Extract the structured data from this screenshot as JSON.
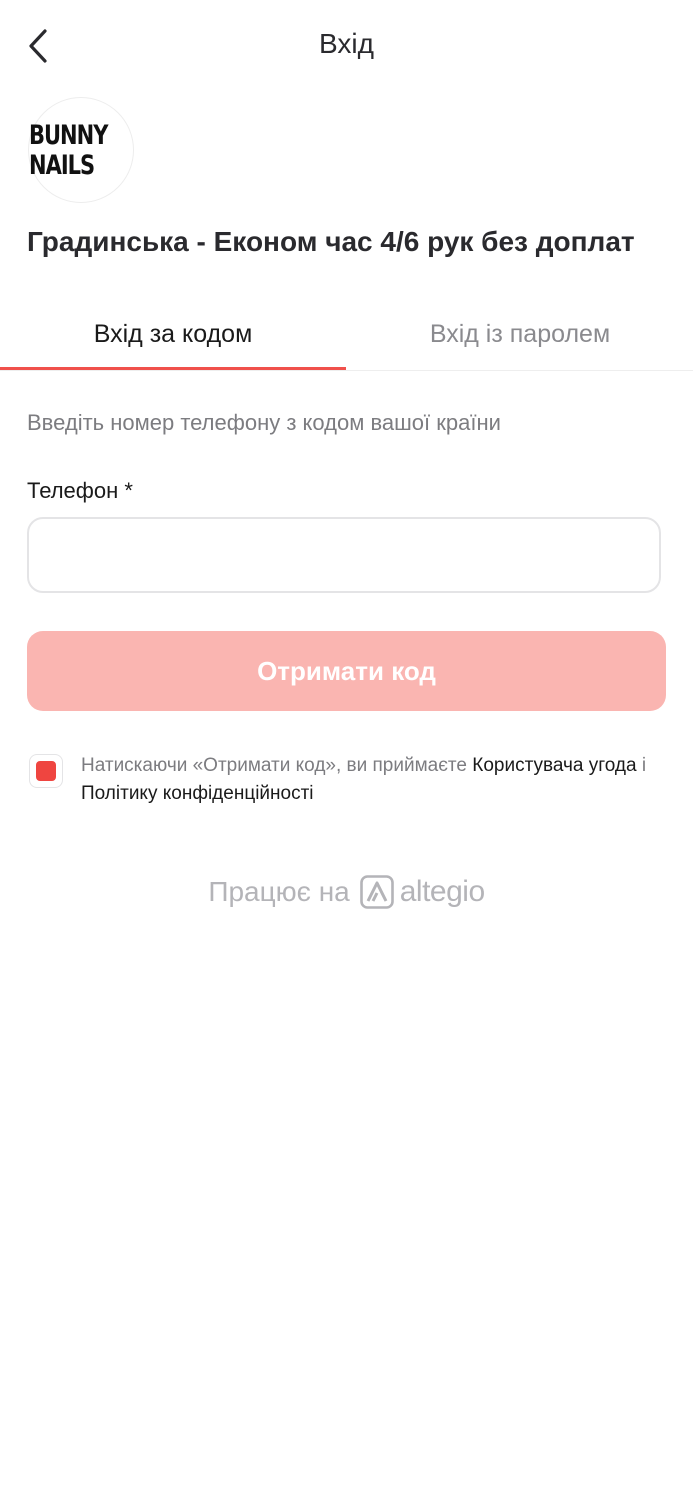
{
  "header": {
    "title": "Вхід",
    "back_icon": "chevron-left-icon"
  },
  "logo": {
    "text_main": "BUNNY NAILS",
    "icon": "bunny-nails-logo"
  },
  "salon": {
    "name": "Градинська - Економ час 4/6 рук без доплат"
  },
  "tabs": [
    {
      "label": "Вхід за кодом",
      "active": true
    },
    {
      "label": "Вхід із паролем",
      "active": false
    }
  ],
  "form": {
    "hint": "Введіть номер телефону з кодом вашої країни",
    "phone_label": "Телефон *",
    "phone_value": "",
    "phone_placeholder": "",
    "submit_label": "Отримати код"
  },
  "consent": {
    "checked": true,
    "text_before": "Натискаючи «Отримати код», ви приймаєте ",
    "agreement_link": "Користувача угода",
    "conjunction": " і ",
    "privacy_link": "Політику конфіденційності"
  },
  "footer": {
    "powered_text": "Працює на",
    "brand": "altegio",
    "brand_icon": "altegio-logo-icon"
  },
  "colors": {
    "accent": "#f0504b",
    "button_disabled": "#fab5b1",
    "checkbox": "#ef4540",
    "muted_text": "#7c7c80"
  }
}
